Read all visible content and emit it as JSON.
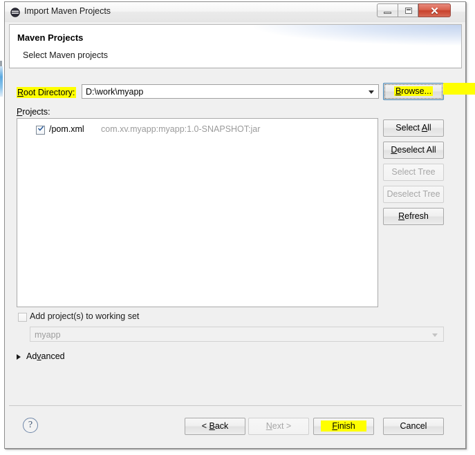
{
  "window": {
    "title": "Import Maven Projects",
    "app_icon": "eclipse-icon",
    "minimize_label": "",
    "maximize_label": "",
    "close_label": "✕"
  },
  "banner": {
    "title": "Maven Projects",
    "subtitle": "Select Maven projects"
  },
  "root_directory": {
    "label_prefix": "R",
    "label_rest": "oot Directory:",
    "value": "D:\\work\\myapp",
    "dropdown_icon": "chevron-down-icon"
  },
  "browse_button": {
    "label_prefix": "B",
    "label_rest": "rowse..."
  },
  "projects": {
    "label_prefix": "P",
    "label_rest": "rojects:",
    "items": [
      {
        "checked": true,
        "name": "/pom.xml",
        "coordinates": "com.xv.myapp:myapp:1.0-SNAPSHOT:jar"
      }
    ]
  },
  "side_buttons": [
    {
      "name": "select-all",
      "prefix": "Select ",
      "mnemonic": "A",
      "suffix": "ll",
      "enabled": true
    },
    {
      "name": "deselect-all",
      "prefix": "",
      "mnemonic": "D",
      "suffix": "eselect All",
      "enabled": true
    },
    {
      "name": "select-tree",
      "prefix": "Select Tree",
      "mnemonic": "",
      "suffix": "",
      "enabled": false
    },
    {
      "name": "deselect-tree",
      "prefix": "Deselect Tree",
      "mnemonic": "",
      "suffix": "",
      "enabled": false
    },
    {
      "name": "refresh",
      "prefix": "",
      "mnemonic": "R",
      "suffix": "efresh",
      "enabled": true
    }
  ],
  "working_set": {
    "checkbox_checked": false,
    "label": "Add project(s) to working set",
    "combo_value": "myapp",
    "combo_enabled": false,
    "dropdown_icon": "chevron-down-icon"
  },
  "advanced": {
    "expander_icon": "triangle-right-icon",
    "label_pre": "Ad",
    "label_mnemonic": "v",
    "label_post": "anced",
    "expanded": false
  },
  "footer": {
    "help_icon": "question-mark-icon",
    "back": {
      "pre": "< ",
      "mnemonic": "B",
      "post": "ack",
      "enabled": true
    },
    "next": {
      "pre": "",
      "mnemonic": "N",
      "post": "ext >",
      "enabled": false
    },
    "finish": {
      "pre": "",
      "mnemonic": "F",
      "post": "inish",
      "enabled": true,
      "highlighted": true
    },
    "cancel": {
      "pre": "Cancel",
      "mnemonic": "",
      "post": "",
      "enabled": true
    }
  },
  "highlights": {
    "color": "#ffff00",
    "marked": [
      "Root Directory:",
      "Browse...",
      "Finish"
    ]
  }
}
